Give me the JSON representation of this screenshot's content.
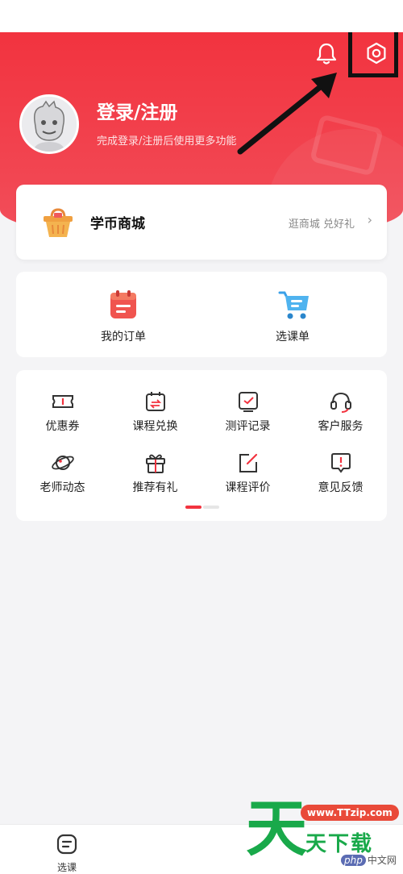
{
  "header": {
    "login_title": "登录/注册",
    "login_subtitle": "完成登录/注册后使用更多功能",
    "bell_icon": "bell-icon",
    "settings_icon": "gear-icon",
    "bg_color": "#f2333f"
  },
  "mall": {
    "title": "学币商城",
    "link": "逛商城 兑好礼",
    "chevron": "›"
  },
  "orders": {
    "my_orders": "我的订单",
    "course_cart": "选课单"
  },
  "grid": {
    "items": [
      {
        "label": "优惠券",
        "icon": "coupon-icon"
      },
      {
        "label": "课程兑换",
        "icon": "exchange-icon"
      },
      {
        "label": "测评记录",
        "icon": "assessment-icon"
      },
      {
        "label": "客户服务",
        "icon": "headset-icon"
      },
      {
        "label": "老师动态",
        "icon": "planet-icon"
      },
      {
        "label": "推荐有礼",
        "icon": "gift-icon"
      },
      {
        "label": "课程评价",
        "icon": "edit-icon"
      },
      {
        "label": "意见反馈",
        "icon": "feedback-icon"
      }
    ]
  },
  "tabbar": {
    "course_tab": "选课"
  },
  "watermark": {
    "big_char": "天",
    "url": "www.TTzip.com",
    "text": "天下载",
    "php_badge": "php",
    "php_text": "中文网"
  },
  "accent_color": "#f2333f"
}
